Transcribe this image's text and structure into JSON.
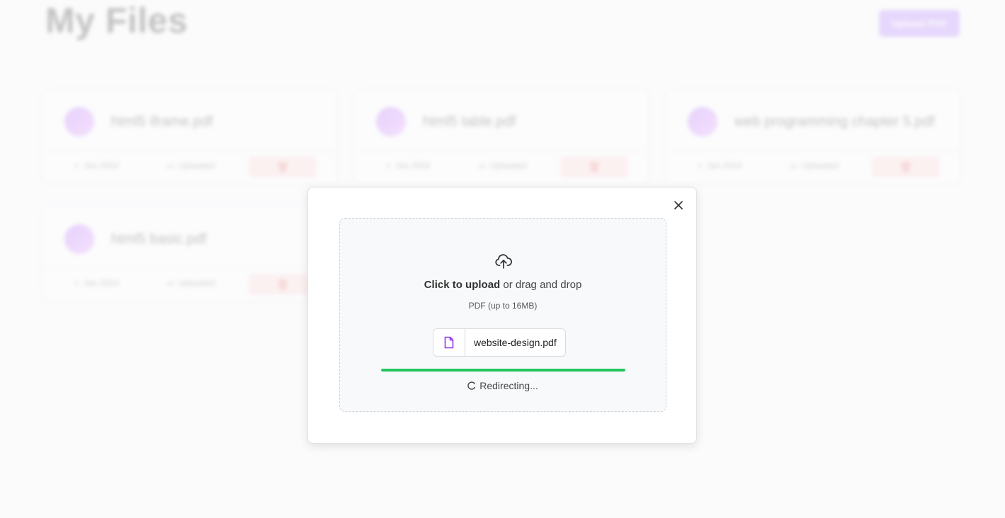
{
  "background": {
    "page_title": "My Files",
    "upload_button_label": "Upload PDF",
    "files": [
      {
        "name": "html5 iframe.pdf",
        "date": "Jan 2024",
        "status": "Uploaded",
        "delete_icon": "trash-icon"
      },
      {
        "name": "html5 table.pdf",
        "date": "Jan 2024",
        "status": "Uploaded",
        "delete_icon": "trash-icon"
      },
      {
        "name": "web programming chapter 5.pdf",
        "date": "Jan 2024",
        "status": "Uploaded",
        "delete_icon": "trash-icon"
      },
      {
        "name": "html5 basic.pdf",
        "date": "Jan 2024",
        "status": "Uploaded",
        "delete_icon": "trash-icon"
      }
    ]
  },
  "modal": {
    "close_icon": "close-icon",
    "upload_icon": "cloud-upload-icon",
    "cta_bold": "Click to upload",
    "cta_rest": "or drag and drop",
    "hint": "PDF (up to 16MB)",
    "file_icon": "file-icon",
    "file_name": "website-design.pdf",
    "progress": 1.0,
    "status_icon": "loader-icon",
    "status_text": "Redirecting..."
  },
  "colors": {
    "accent": "#9333ea",
    "progress": "#22c55e",
    "danger": "#e04444"
  }
}
